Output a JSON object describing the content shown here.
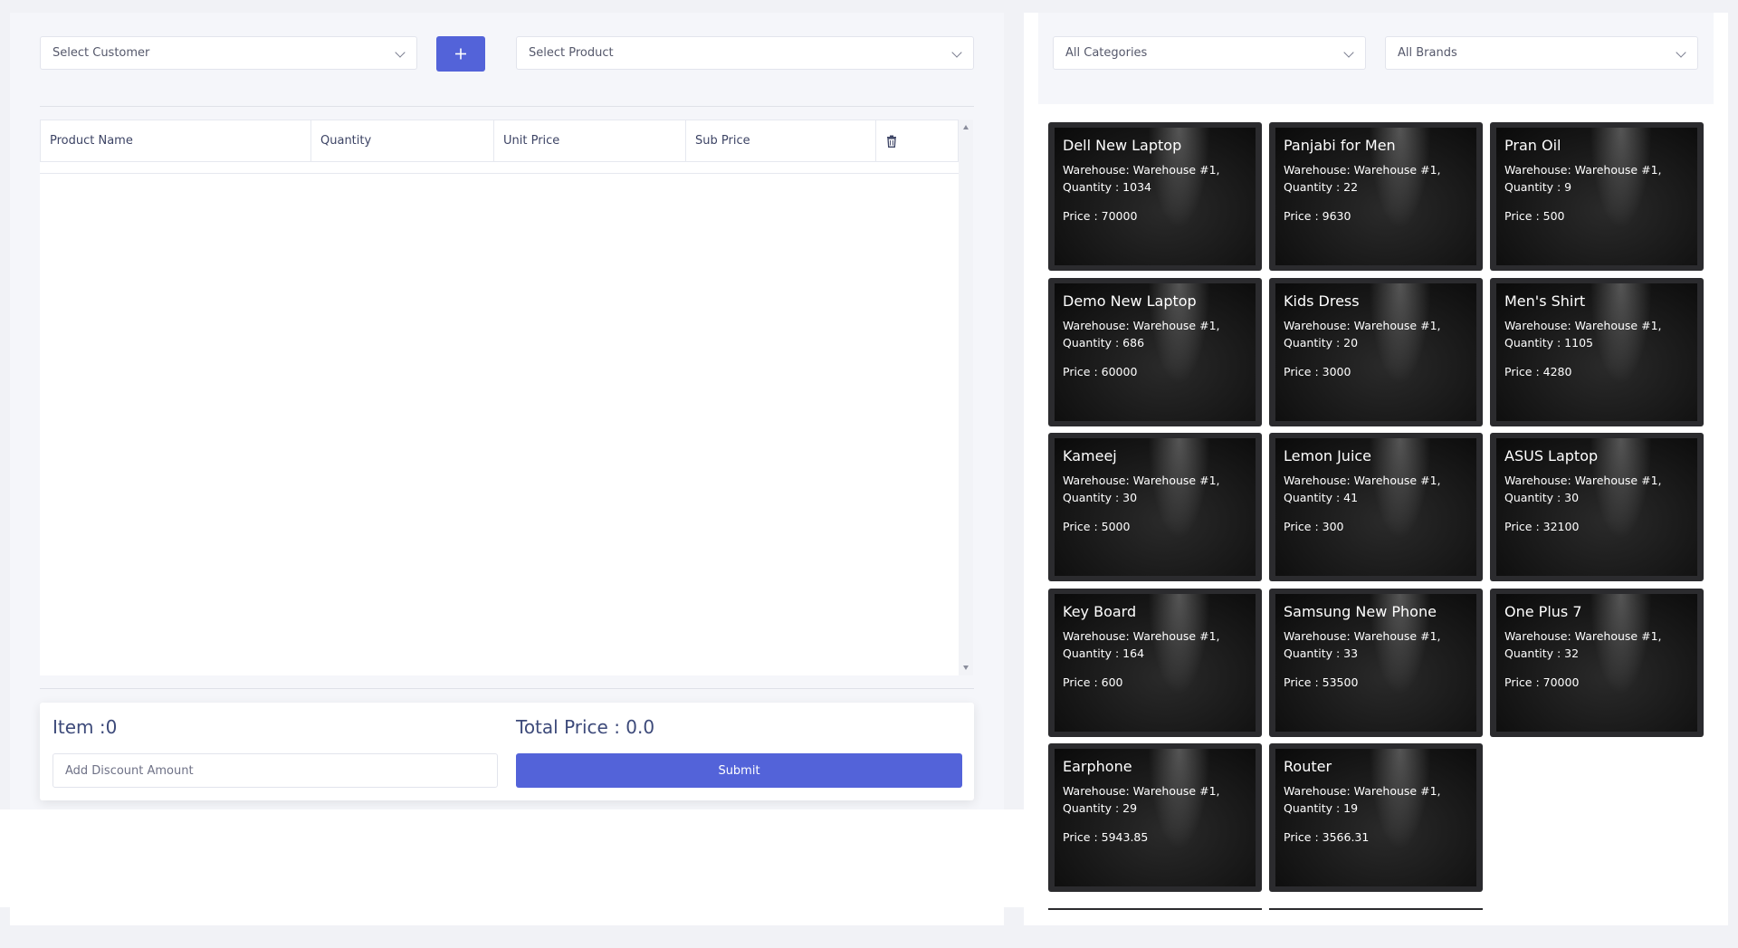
{
  "customer_select": {
    "placeholder": "Select Customer"
  },
  "add_customer_button": {
    "label": "+"
  },
  "product_select": {
    "placeholder": "Select Product"
  },
  "table": {
    "headers": [
      "Product Name",
      "Quantity",
      "Unit Price",
      "Sub Price"
    ],
    "delete_icon": "trash-icon",
    "rows": []
  },
  "summary": {
    "item_label": "Item :0",
    "total_label": "Total Price : 0.0",
    "discount_placeholder": "Add Discount Amount",
    "submit_label": "Submit"
  },
  "filters": {
    "category": "All Categories",
    "brand": "All Brands"
  },
  "products": [
    {
      "name": "Dell New Laptop",
      "warehouse": "Warehouse: Warehouse #1,",
      "quantity": "Quantity : 1034",
      "price": "Price : 70000"
    },
    {
      "name": "Panjabi for Men",
      "warehouse": "Warehouse: Warehouse #1,",
      "quantity": "Quantity : 22",
      "price": "Price : 9630"
    },
    {
      "name": "Pran Oil",
      "warehouse": "Warehouse: Warehouse #1,",
      "quantity": "Quantity : 9",
      "price": "Price : 500"
    },
    {
      "name": "Demo New Laptop",
      "warehouse": "Warehouse: Warehouse #1,",
      "quantity": "Quantity : 686",
      "price": "Price : 60000"
    },
    {
      "name": "Kids Dress",
      "warehouse": "Warehouse: Warehouse #1,",
      "quantity": "Quantity : 20",
      "price": "Price : 3000"
    },
    {
      "name": "Men's Shirt",
      "warehouse": "Warehouse: Warehouse #1,",
      "quantity": "Quantity : 1105",
      "price": "Price : 4280"
    },
    {
      "name": "Kameej",
      "warehouse": "Warehouse: Warehouse #1,",
      "quantity": "Quantity : 30",
      "price": "Price : 5000"
    },
    {
      "name": "Lemon Juice",
      "warehouse": "Warehouse: Warehouse #1,",
      "quantity": "Quantity : 41",
      "price": "Price : 300"
    },
    {
      "name": "ASUS Laptop",
      "warehouse": "Warehouse: Warehouse #1,",
      "quantity": "Quantity : 30",
      "price": "Price : 32100"
    },
    {
      "name": "Key Board",
      "warehouse": "Warehouse: Warehouse #1,",
      "quantity": "Quantity : 164",
      "price": "Price : 600"
    },
    {
      "name": "Samsung New Phone",
      "warehouse": "Warehouse: Warehouse #1,",
      "quantity": "Quantity : 33",
      "price": "Price : 53500"
    },
    {
      "name": "One Plus 7",
      "warehouse": "Warehouse: Warehouse #1,",
      "quantity": "Quantity : 32",
      "price": "Price : 70000"
    },
    {
      "name": "Earphone",
      "warehouse": "Warehouse: Warehouse #1,",
      "quantity": "Quantity : 29",
      "price": "Price : 5943.85"
    },
    {
      "name": "Router",
      "warehouse": "Warehouse: Warehouse #1,",
      "quantity": "Quantity : 19",
      "price": "Price : 3566.31"
    }
  ],
  "colors": {
    "accent": "#5363d9",
    "page_bg": "#f1f2f6",
    "card_border": "#2b2b2e",
    "heading_text": "#3d4a7a"
  }
}
